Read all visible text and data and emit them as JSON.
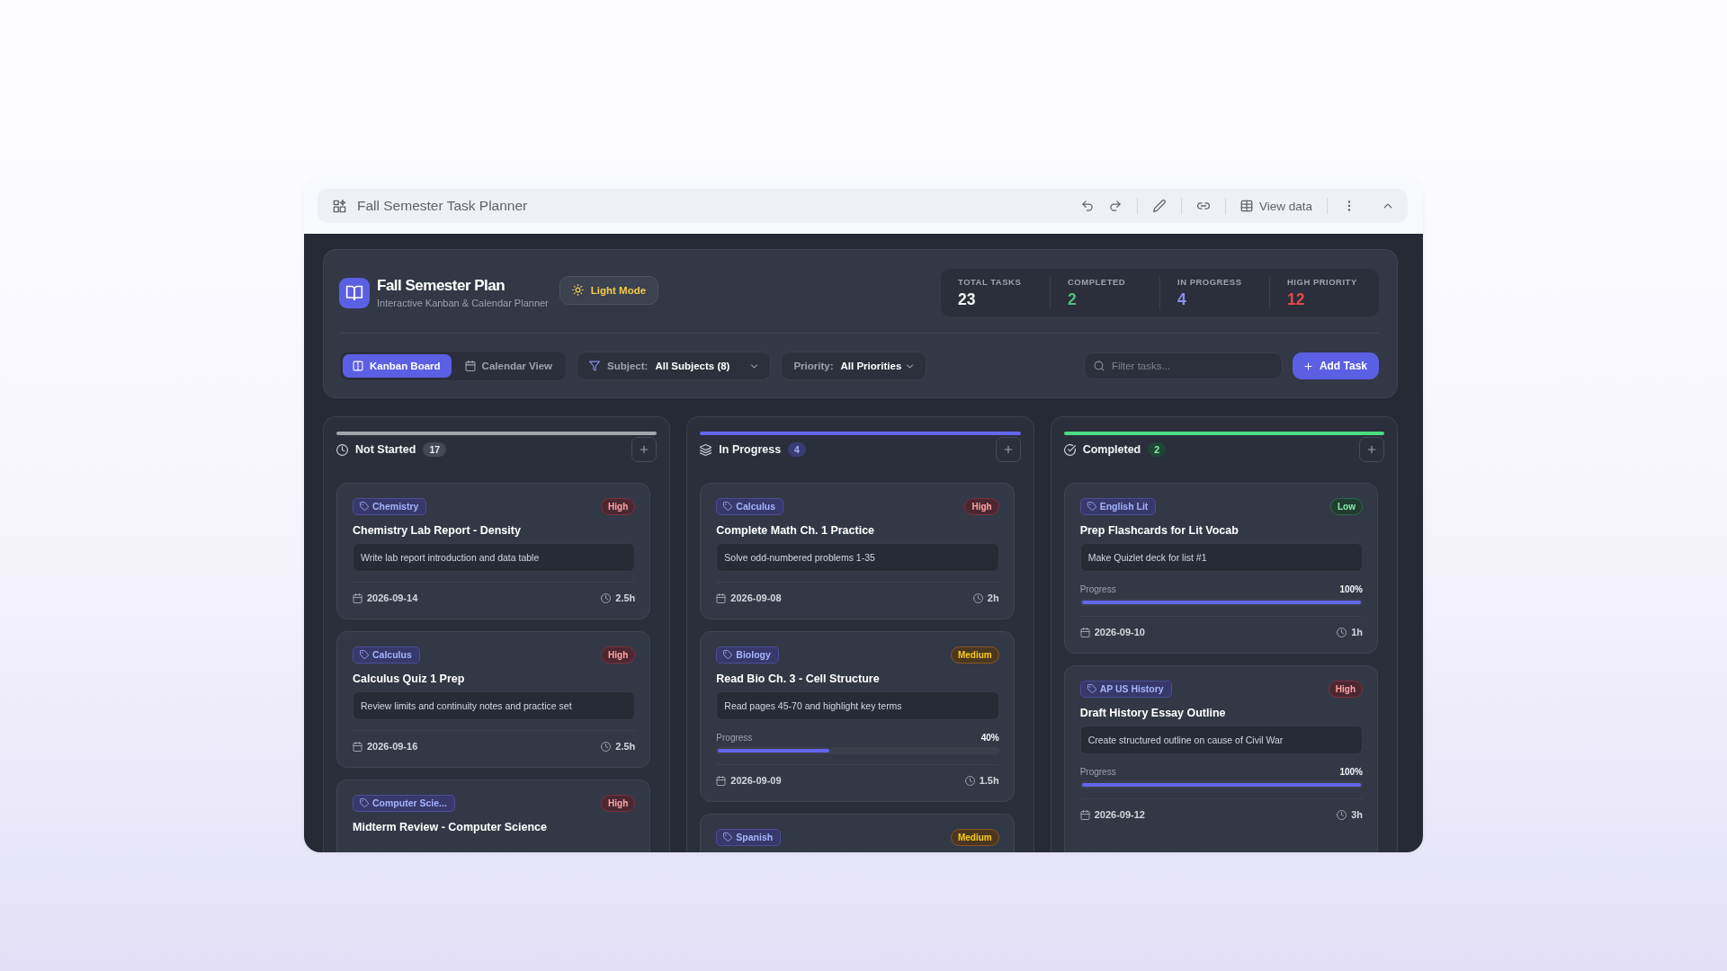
{
  "app_bar": {
    "title": "Fall Semester Task Planner",
    "view_data_label": "View data"
  },
  "header": {
    "title": "Fall Semester Plan",
    "subtitle": "Interactive Kanban & Calendar Planner",
    "theme_button": "Light Mode",
    "stats": [
      {
        "label": "TOTAL TASKS",
        "value": "23",
        "color": "#f3f4f6"
      },
      {
        "label": "COMPLETED",
        "value": "2",
        "color": "#4fbf7c"
      },
      {
        "label": "IN PROGRESS",
        "value": "4",
        "color": "#8b8ff5"
      },
      {
        "label": "HIGH PRIORITY",
        "value": "12",
        "color": "#e5484d"
      }
    ]
  },
  "toolbar": {
    "views": [
      {
        "label": "Kanban Board",
        "kind": "board",
        "selected": true
      },
      {
        "label": "Calendar View",
        "kind": "calendar",
        "selected": false
      }
    ],
    "filters": [
      {
        "kind": "subject",
        "label": "Subject:",
        "value": "All Subjects (8)"
      },
      {
        "kind": "priority",
        "label": "Priority:",
        "value": "All Priorities"
      }
    ],
    "search": {
      "placeholder": "Filter tasks..."
    },
    "add_button": "Add Task"
  },
  "columns": [
    {
      "title": "Not Started",
      "count": "17",
      "kind": "todo",
      "color": "#a1a5ae",
      "cards": [
        {
          "subject": "Chemistry",
          "priority": {
            "label": "High",
            "kind": "high"
          },
          "title": "Chemistry Lab Report - Density",
          "description": "Write lab report introduction and data table",
          "date": "2026-09-14",
          "duration": "2.5h"
        },
        {
          "subject": "Calculus",
          "priority": {
            "label": "High",
            "kind": "high"
          },
          "title": "Calculus Quiz 1 Prep",
          "description": "Review limits and continuity notes and practice set",
          "date": "2026-09-16",
          "duration": "2.5h"
        },
        {
          "subject": "Computer Scie...",
          "priority": {
            "label": "High",
            "kind": "high"
          },
          "title": "Midterm Review - Computer Science"
        }
      ]
    },
    {
      "title": "In Progress",
      "count": "4",
      "kind": "doing",
      "color": "#6366f1",
      "cards": [
        {
          "subject": "Calculus",
          "priority": {
            "label": "High",
            "kind": "high"
          },
          "title": "Complete Math Ch. 1 Practice",
          "description": "Solve odd-numbered problems 1-35",
          "date": "2026-09-08",
          "duration": "2h"
        },
        {
          "subject": "Biology",
          "priority": {
            "label": "Medium",
            "kind": "medium"
          },
          "title": "Read Bio Ch. 3 - Cell Structure",
          "description": "Read pages 45-70 and highlight key terms",
          "progress": {
            "label": "Progress",
            "reading": "40%",
            "level": 0.4
          },
          "date": "2026-09-09",
          "duration": "1.5h"
        },
        {
          "subject": "Spanish",
          "priority": {
            "label": "Medium",
            "kind": "medium"
          }
        }
      ]
    },
    {
      "title": "Completed",
      "count": "2",
      "kind": "done",
      "color": "#4ade80",
      "cards": [
        {
          "subject": "English Lit",
          "priority": {
            "label": "Low",
            "kind": "low"
          },
          "title": "Prep Flashcards for Lit Vocab",
          "description": "Make Quizlet deck for list #1",
          "progress": {
            "label": "Progress",
            "reading": "100%",
            "level": 1
          },
          "date": "2026-09-10",
          "duration": "1h"
        },
        {
          "subject": "AP US History",
          "priority": {
            "label": "High",
            "kind": "high"
          },
          "title": "Draft History Essay Outline",
          "description": "Create structured outline on cause of Civil War",
          "progress": {
            "label": "Progress",
            "reading": "100%",
            "level": 1
          },
          "date": "2026-09-12",
          "duration": "3h"
        }
      ]
    }
  ]
}
